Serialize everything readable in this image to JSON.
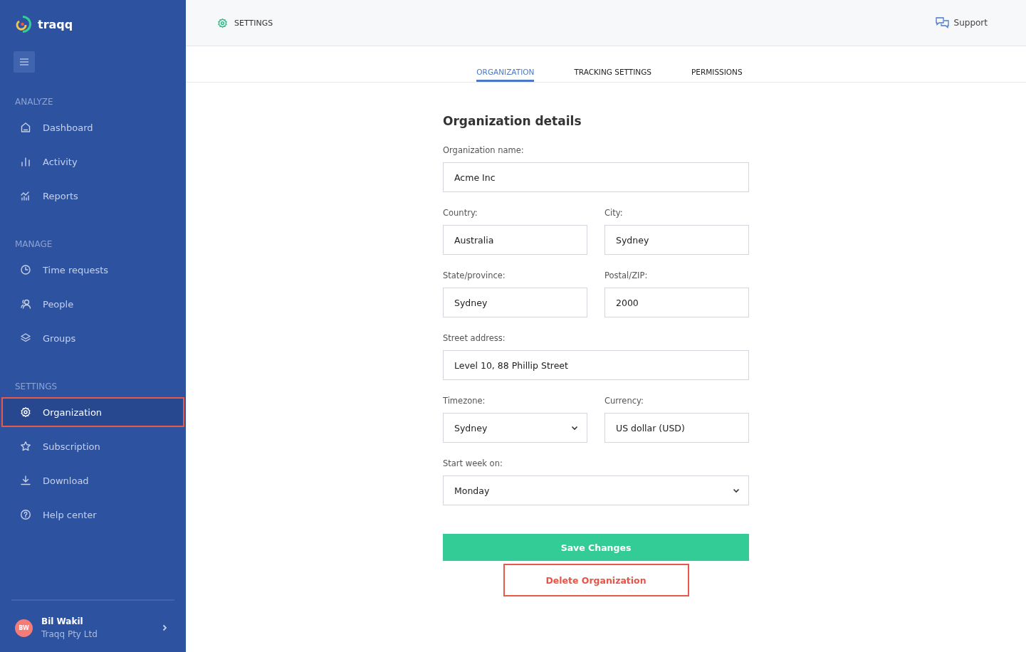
{
  "sidebar": {
    "logo": "traqq",
    "sections": [
      {
        "title": "ANALYZE",
        "items": [
          {
            "label": "Dashboard",
            "selected": false,
            "highlighted": false
          },
          {
            "label": "Activity",
            "selected": false,
            "highlighted": false
          },
          {
            "label": "Reports",
            "selected": false,
            "highlighted": false
          }
        ]
      },
      {
        "title": "MANAGE",
        "items": [
          {
            "label": "Time requests",
            "selected": false,
            "highlighted": false
          },
          {
            "label": "People",
            "selected": false,
            "highlighted": false
          },
          {
            "label": "Groups",
            "selected": false,
            "highlighted": false
          }
        ]
      },
      {
        "title": "SETTINGS",
        "items": [
          {
            "label": "Organization",
            "selected": true,
            "highlighted": true
          },
          {
            "label": "Subscription",
            "selected": false,
            "highlighted": false
          },
          {
            "label": "Download",
            "selected": false,
            "highlighted": false
          },
          {
            "label": "Help center",
            "selected": false,
            "highlighted": false
          }
        ]
      }
    ],
    "user": {
      "initials": "BW",
      "name": "Bil Wakil",
      "company": "Traqq Pty Ltd"
    }
  },
  "header": {
    "title": "SETTINGS",
    "support": "Support"
  },
  "tabs": [
    {
      "label": "ORGANIZATION",
      "selected": true
    },
    {
      "label": "TRACKING SETTINGS",
      "selected": false
    },
    {
      "label": "PERMISSIONS",
      "selected": false
    }
  ],
  "form": {
    "title": "Organization details",
    "rows": [
      [
        {
          "label": "Organization name:",
          "value": "Acme Inc",
          "kind": "text"
        }
      ],
      [
        {
          "label": "Country:",
          "value": "Australia",
          "kind": "text"
        },
        {
          "label": "City:",
          "value": "Sydney",
          "kind": "text"
        }
      ],
      [
        {
          "label": "State/province:",
          "value": "Sydney",
          "kind": "text"
        },
        {
          "label": "Postal/ZIP:",
          "value": "2000",
          "kind": "text"
        }
      ],
      [
        {
          "label": "Street address:",
          "value": "Level 10, 88 Phillip Street",
          "kind": "text"
        }
      ],
      [
        {
          "label": "Timezone:",
          "value": "Sydney",
          "kind": "select"
        },
        {
          "label": "Currency:",
          "value": "US dollar (USD)",
          "kind": "text"
        }
      ],
      [
        {
          "label": "Start week on:",
          "value": "Monday",
          "kind": "select"
        }
      ]
    ],
    "save_button": "Save Changes",
    "delete_button": {
      "label": "Delete Organization",
      "highlighted": true
    }
  }
}
